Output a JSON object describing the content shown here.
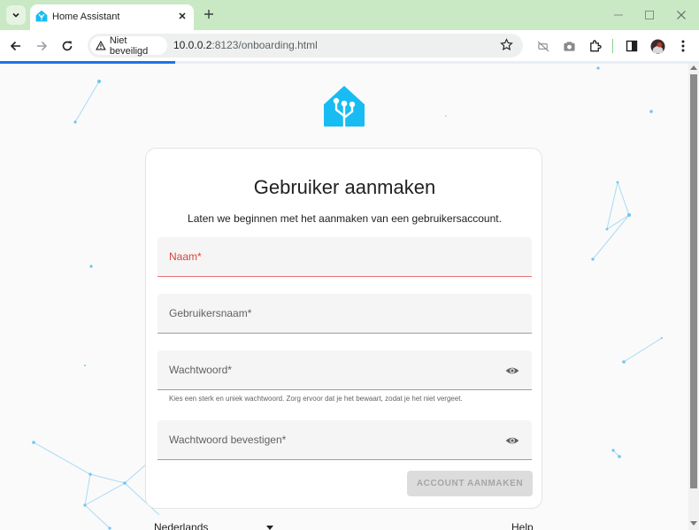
{
  "browser": {
    "tab_title": "Home Assistant",
    "security_label": "Niet beveiligd",
    "url_host": "10.0.0.2",
    "url_rest": ":8123/onboarding.html",
    "page_load_progress": 0.25
  },
  "page": {
    "title": "Gebruiker aanmaken",
    "subtitle": "Laten we beginnen met het aanmaken van een gebruikersaccount.",
    "fields": {
      "name_label": "Naam*",
      "username_label": "Gebruikersnaam*",
      "password_label": "Wachtwoord*",
      "password_helper": "Kies een sterk en uniek wachtwoord. Zorg ervoor dat je het bewaart, zodat je het niet vergeet.",
      "confirm_label": "Wachtwoord bevestigen*"
    },
    "submit_label": "ACCOUNT AANMAKEN",
    "footer": {
      "language": "Nederlands",
      "help": "Help"
    }
  },
  "colors": {
    "brand": "#18bcf2",
    "error": "#db4437",
    "tabstrip": "#c9e8c4"
  },
  "icons": {
    "tab_menu": "chevron-down-icon",
    "tab_close": "close-icon",
    "new_tab": "plus-icon",
    "back": "arrow-left-icon",
    "forward": "arrow-right-icon",
    "reload": "reload-icon",
    "warning": "warning-triangle-icon",
    "bookmark": "star-icon",
    "password_toggle": "eye-icon"
  }
}
